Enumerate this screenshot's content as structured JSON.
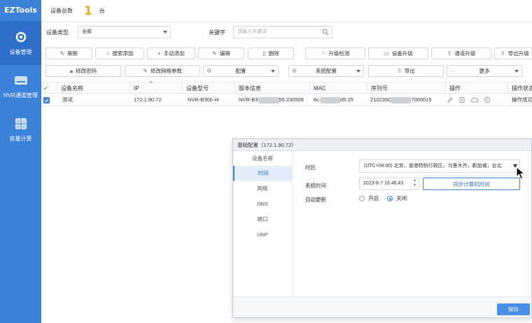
{
  "app": {
    "title": "EZTools"
  },
  "sidebar": {
    "items": [
      {
        "label": "设备管理",
        "icon": "gear-icon",
        "active": true
      },
      {
        "label": "NVR通道管理",
        "icon": "nvr-icon",
        "active": false
      },
      {
        "label": "容量计算",
        "icon": "calculator-icon",
        "active": false
      }
    ]
  },
  "header": {
    "total_label": "设备总数",
    "total_count": "1",
    "unit": "台"
  },
  "filter": {
    "device_type_label": "设备类型",
    "device_type_value": "全部",
    "keyword_label": "关键字",
    "keyword_placeholder": "请输入关键词"
  },
  "toolbar": {
    "row1": [
      "刷新",
      "搜索添加",
      "手动添加",
      "编辑",
      "删除",
      "升级检测",
      "设备升级",
      "通道升级",
      "导出升级"
    ],
    "row2": {
      "change_password": "修改密码",
      "change_network": "修改网络参数",
      "config": "配置",
      "system_config": "系统配置",
      "export": "导出",
      "more": "更多"
    }
  },
  "table": {
    "headers": [
      "设备名称",
      "IP",
      "设备型号",
      "版本信息",
      "MAC",
      "序列号",
      "操作",
      "操作状态"
    ],
    "rows": [
      {
        "checked": true,
        "name": "测试",
        "ip": "172.1.90.72",
        "model": "NVR-B300-I4",
        "version_prefix": "NVR-B3",
        "version_suffix": "55.230509",
        "mac_prefix": "6c:",
        "mac_suffix": "d5:25",
        "serial_prefix": "210235C",
        "serial_suffix": "7000015",
        "status": "操作成功"
      }
    ]
  },
  "dialog": {
    "title": "基础配置（172.1.90.72）",
    "nav": [
      "设备名称",
      "时间",
      "网络",
      "DNS",
      "端口",
      "UNP"
    ],
    "active_nav": "时间",
    "timezone_label": "时区",
    "timezone_value": "(UTC+08:00) 北京，香港特别行政区，乌鲁木齐，新加坡，台北",
    "system_time_label": "系统时间",
    "system_time_value": "2023-8-7 16:46:43",
    "sync_button": "同步计算机时间",
    "auto_update_label": "自动更新",
    "auto_on": "开启",
    "auto_off": "关闭",
    "auto_update_value": "关闭",
    "save_button": "保存"
  },
  "colors": {
    "accent": "#3b82db",
    "sidebar": "#3b82db",
    "count": "#f5a623"
  }
}
